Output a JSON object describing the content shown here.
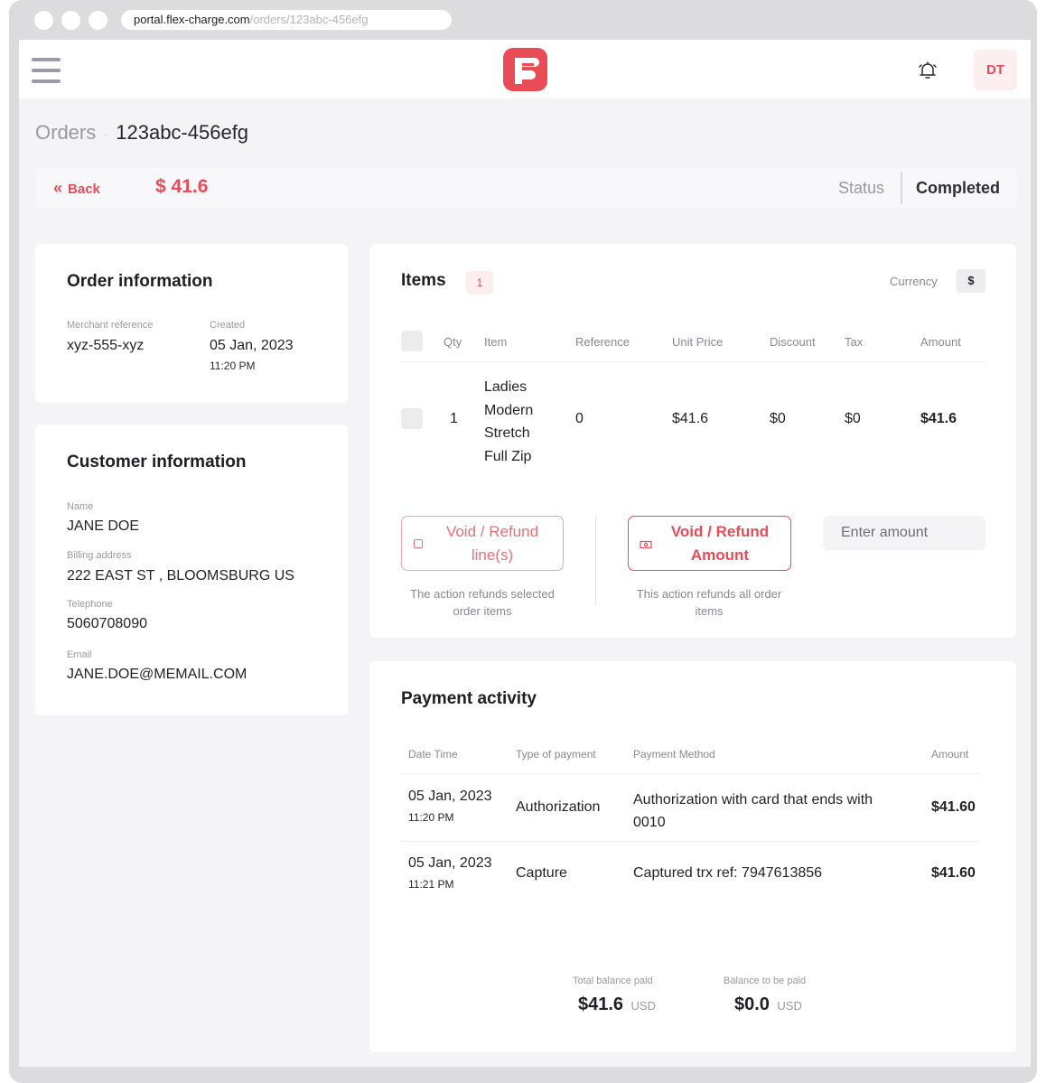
{
  "browser": {
    "url_host": "portal.flex-charge.com",
    "url_path": "/orders/123abc-456efg"
  },
  "header": {
    "user_initials": "DT",
    "logo_icon": "flexcharge-logo-icon",
    "bell_icon": "bell-icon",
    "menu_icon": "hamburger-menu-icon"
  },
  "breadcrumb": {
    "parent": "Orders",
    "separator": "·",
    "current": "123abc-456efg"
  },
  "actionbar": {
    "back_label": "Back",
    "back_icon": "«",
    "total": "$ 41.6",
    "status_label": "Status",
    "status_value": "Completed"
  },
  "order_info": {
    "title": "Order information",
    "merchant_reference_label": "Merchant reference",
    "merchant_reference": "xyz-555-xyz",
    "created_label": "Created",
    "created_date": "05 Jan, 2023",
    "created_time": "11:20 PM"
  },
  "customer_info": {
    "title": "Customer information",
    "name_label": "Name",
    "name": "JANE DOE",
    "billing_label": "Billing address",
    "billing": "222 EAST ST , BLOOMSBURG US",
    "telephone_label": "Telephone",
    "telephone": "5060708090",
    "email_label": "Email",
    "email": "JANE.DOE@MEMAIL.COM"
  },
  "items": {
    "title": "Items",
    "count": "1",
    "currency_label": "Currency",
    "currency_symbol": "$",
    "columns": [
      "Qty",
      "Item",
      "Reference",
      "Unit Price",
      "Discount",
      "Tax",
      "Amount"
    ],
    "rows": [
      {
        "qty": "1",
        "item_lines": [
          "Ladies",
          "Modern",
          "Stretch",
          "Full Zip"
        ],
        "reference": "0",
        "unit_price": "$41.6",
        "discount": "$0",
        "tax": "$0",
        "amount": "$41.6"
      }
    ],
    "refund_lines_label_1": "Void / Refund",
    "refund_lines_label_2": "line(s)",
    "refund_lines_help_1": "The action refunds selected",
    "refund_lines_help_2": "order items",
    "refund_amount_label_1": "Void / Refund",
    "refund_amount_label_2": "Amount",
    "refund_amount_help_1": "This action refunds all order",
    "refund_amount_help_2": "items",
    "amount_placeholder": "Enter amount"
  },
  "payment_activity": {
    "title": "Payment activity",
    "columns": [
      "Date Time",
      "Type of payment",
      "Payment Method",
      "Amount"
    ],
    "rows": [
      {
        "date": "05 Jan, 2023",
        "time": "11:20 PM",
        "type": "Authorization",
        "method_line1": "Authorization with card that ends with",
        "method_line2": "0010",
        "amount": "$41.60"
      },
      {
        "date": "05 Jan, 2023",
        "time": "11:21 PM",
        "type": "Capture",
        "method_line1": "Captured trx ref: 7947613856",
        "method_line2": "",
        "amount": "$41.60"
      }
    ],
    "total_paid_label": "Total balance paid",
    "total_paid": "$41.6",
    "total_paid_currency": "USD",
    "to_be_paid_label": "Balance to be paid",
    "to_be_paid": "$0.0",
    "to_be_paid_currency": "USD"
  },
  "colors": {
    "accent": "#e94b57",
    "page_background": "#f4f4f6",
    "card_background": "#ffffff"
  }
}
